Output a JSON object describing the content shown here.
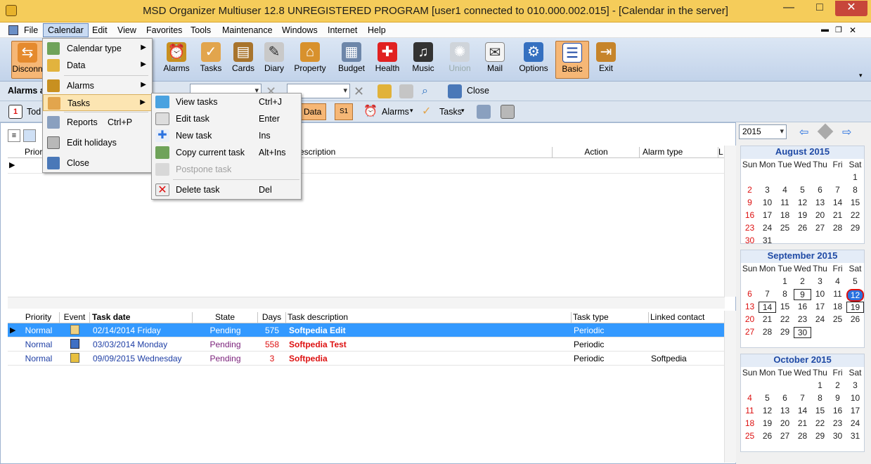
{
  "window": {
    "title": "MSD Organizer Multiuser 12.8 UNREGISTERED PROGRAM [user1 connected to 010.000.002.015] - [Calendar in the server]",
    "minimize": "—",
    "maximize": "□",
    "close": "✕"
  },
  "menubar": [
    "File",
    "Calendar",
    "Edit",
    "View",
    "Favorites",
    "Tools",
    "Maintenance",
    "Windows",
    "Internet",
    "Help"
  ],
  "toolbar": [
    {
      "label": "Disconn"
    },
    {
      "label": "Alarms"
    },
    {
      "label": "Tasks"
    },
    {
      "label": "Cards"
    },
    {
      "label": "Diary"
    },
    {
      "label": "Property"
    },
    {
      "label": "Budget"
    },
    {
      "label": "Health"
    },
    {
      "label": "Music"
    },
    {
      "label": "Union"
    },
    {
      "label": "Mail"
    },
    {
      "label": "Options"
    },
    {
      "label": "Basic"
    },
    {
      "label": "Exit"
    }
  ],
  "toolbar2": {
    "alarms_label": "Alarms a",
    "close_label": "Close"
  },
  "toolbar3": {
    "today": "Tod",
    "data": "Data",
    "alarms": "Alarms",
    "tasks": "Tasks",
    "tag": "1",
    "s1": "S1"
  },
  "calendar_menu": [
    {
      "label": "Calendar type",
      "submenu": true
    },
    {
      "label": "Data",
      "submenu": true
    },
    {
      "label": "Alarms",
      "submenu": true
    },
    {
      "label": "Tasks",
      "submenu": true
    },
    {
      "label": "Reports",
      "shortcut": "Ctrl+P"
    },
    {
      "label": "Edit holidays"
    },
    {
      "label": "Close"
    }
  ],
  "tasks_submenu": [
    {
      "label": "View tasks",
      "shortcut": "Ctrl+J"
    },
    {
      "label": "Edit task",
      "shortcut": "Enter"
    },
    {
      "label": "New task",
      "shortcut": "Ins"
    },
    {
      "label": "Copy current task",
      "shortcut": "Alt+Ins"
    },
    {
      "label": "Postpone task",
      "shortcut": ""
    },
    {
      "label": "Delete task",
      "shortcut": "Del"
    }
  ],
  "top_grid": {
    "columns": [
      "Priori",
      "escription",
      "Action",
      "Alarm type",
      "L"
    ]
  },
  "task_grid": {
    "columns": [
      "Priority",
      "Event",
      "Task date",
      "State",
      "Days",
      "Task description",
      "Task type",
      "Linked contact"
    ],
    "rows": [
      {
        "priority": "Normal",
        "date": "02/14/2014 Friday",
        "state": "Pending",
        "days": "575",
        "description": "Softpedia Edit",
        "type": "Periodic",
        "contact": ""
      },
      {
        "priority": "Normal",
        "date": "03/03/2014 Monday",
        "state": "Pending",
        "days": "558",
        "description": "Softpedia Test",
        "type": "Periodic",
        "contact": ""
      },
      {
        "priority": "Normal",
        "date": "09/09/2015 Wednesday",
        "state": "Pending",
        "days": "3",
        "description": "Softpedia",
        "type": "Periodic",
        "contact": "Softpedia"
      }
    ]
  },
  "calendar_panel": {
    "year": "2015",
    "weekdays": [
      "Sun",
      "Mon",
      "Tue",
      "Wed",
      "Thu",
      "Fri",
      "Sat"
    ],
    "months": [
      {
        "title": "August 2015",
        "start": 6,
        "days": 31
      },
      {
        "title": "September 2015",
        "start": 2,
        "days": 30
      },
      {
        "title": "October 2015",
        "start": 4,
        "days": 31
      }
    ]
  }
}
